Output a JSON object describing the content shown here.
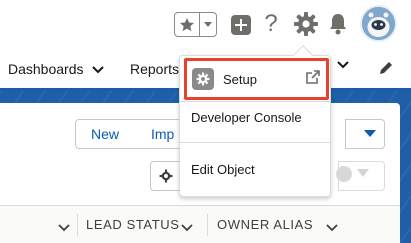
{
  "header": {
    "favorites_icon": "star-icon",
    "favorites_menu_icon": "caret-down-icon",
    "add_icon": "plus-icon",
    "help_icon": "question-icon",
    "help_glyph": "?",
    "setup_icon": "gear-icon",
    "notifications_icon": "bell-icon",
    "avatar_icon": "astro-avatar-icon"
  },
  "nav": {
    "items": [
      {
        "label": "Dashboards",
        "icon": "chevron-down-icon"
      },
      {
        "label": "Reports",
        "icon": "chevron-down-icon"
      }
    ],
    "edit_icon": "pencil-icon"
  },
  "setup_menu": {
    "items": [
      {
        "label": "Setup",
        "icon": "gear-icon",
        "trailing_icon": "external-link-icon",
        "highlighted": true
      },
      {
        "label": "Developer Console"
      },
      {
        "label": "Edit Object"
      }
    ],
    "highlight_color": "#e8412e"
  },
  "toolbar": {
    "new_label": "New",
    "import_label": "Imp",
    "more_icon": "caret-down-icon",
    "settings_icon": "gear-icon",
    "chart_icon": "pie-chart-icon",
    "filter_icon": "filter-icon"
  },
  "table": {
    "columns": [
      {
        "label": "",
        "icon": "chevron-down-icon"
      },
      {
        "label": "LEAD STATUS",
        "icon": "chevron-down-icon"
      },
      {
        "label": "OWNER ALIAS",
        "icon": "chevron-down-icon"
      }
    ]
  },
  "colors": {
    "brand_blue": "#1f5fa8",
    "link_blue": "#0b5cab",
    "icon_gray": "#706e6b"
  }
}
